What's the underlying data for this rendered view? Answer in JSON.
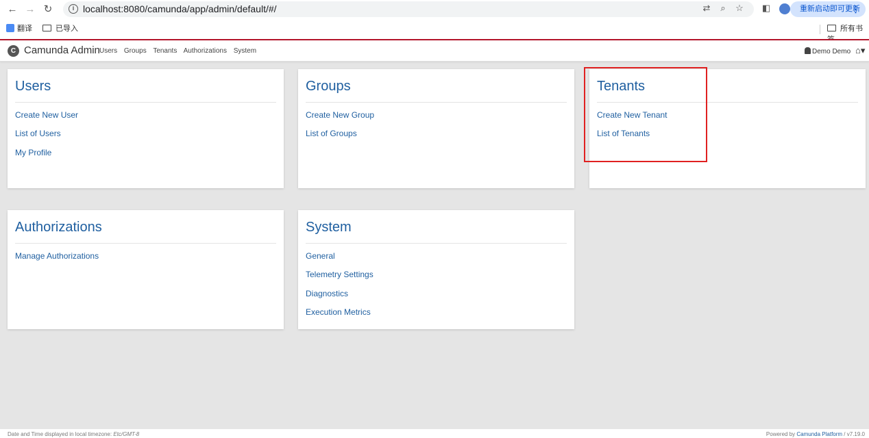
{
  "browser": {
    "url": "localhost:8080/camunda/app/admin/default/#/",
    "restart_label": "重新启动即可更新",
    "bookmarks": [
      "翻译",
      "已导入"
    ],
    "all_bookmarks": "所有书签"
  },
  "header": {
    "brand": "Camunda Admin",
    "nav": [
      "Users",
      "Groups",
      "Tenants",
      "Authorizations",
      "System"
    ],
    "user": "Demo Demo"
  },
  "cards": [
    {
      "title": "Users",
      "links": [
        "Create New User",
        "List of Users",
        "My Profile"
      ]
    },
    {
      "title": "Groups",
      "links": [
        "Create New Group",
        "List of Groups"
      ]
    },
    {
      "title": "Tenants",
      "links": [
        "Create New Tenant",
        "List of Tenants"
      ]
    },
    {
      "title": "Authorizations",
      "links": [
        "Manage Authorizations"
      ]
    },
    {
      "title": "System",
      "links": [
        "General",
        "Telemetry Settings",
        "Diagnostics",
        "Execution Metrics"
      ]
    }
  ],
  "footer": {
    "tz_prefix": "Date and Time displayed in local timezone: ",
    "tz_value": "Etc/GMT-8",
    "powered_prefix": "Powered by ",
    "powered_link": "Camunda Platform",
    "version": " / v7.19.0"
  },
  "colors": {
    "link": "#1f5fa0",
    "highlight": "#e02020",
    "brand_accent": "#b5152b"
  }
}
